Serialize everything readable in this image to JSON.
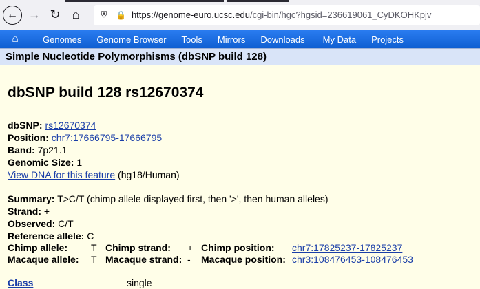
{
  "browser": {
    "url_host": "https://genome-euro.ucsc.edu",
    "url_path": "/cgi-bin/hgc?hgsid=236619061_CyDKOHKpjv"
  },
  "nav": {
    "items": [
      "Genomes",
      "Genome Browser",
      "Tools",
      "Mirrors",
      "Downloads",
      "My Data",
      "Projects"
    ]
  },
  "section_title": "Simple Nucleotide Polymorphisms (dbSNP build 128)",
  "page_title": "dbSNP build 128 rs12670374",
  "details": {
    "dbsnp_label": "dbSNP:",
    "dbsnp_value": "rs12670374",
    "position_label": "Position:",
    "position_value": "chr7:17666795-17666795",
    "band_label": "Band:",
    "band_value": "7p21.1",
    "size_label": "Genomic Size:",
    "size_value": "1",
    "view_dna_link": "View DNA for this feature",
    "view_dna_suffix": "(hg18/Human)"
  },
  "summary": {
    "summary_label": "Summary:",
    "summary_value": "T>C/T (chimp allele displayed first, then '>', then human alleles)",
    "strand_label": "Strand:",
    "strand_value": "+",
    "observed_label": "Observed:",
    "observed_value": "C/T",
    "ref_label": "Reference allele:",
    "ref_value": "C"
  },
  "orthologs": {
    "chimp_allele_label": "Chimp allele:",
    "chimp_allele": "T",
    "chimp_strand_label": "Chimp strand:",
    "chimp_strand": "+",
    "chimp_pos_label": "Chimp position:",
    "chimp_pos": "chr7:17825237-17825237",
    "macaque_allele_label": "Macaque allele:",
    "macaque_allele": "T",
    "macaque_strand_label": "Macaque strand:",
    "macaque_strand": "-",
    "macaque_pos_label": "Macaque position:",
    "macaque_pos": "chr3:108476453-108476453"
  },
  "class_row": {
    "label": "Class",
    "value": "single"
  }
}
